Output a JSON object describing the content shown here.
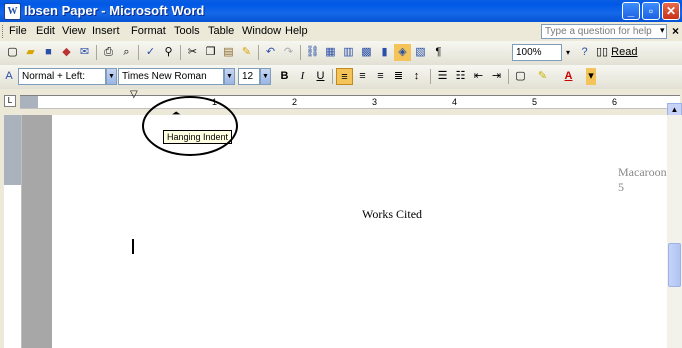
{
  "window": {
    "title": "Ibsen Paper - Microsoft Word",
    "app_icon_glyph": "W",
    "buttons": {
      "minimize": "_",
      "maximize": "▫",
      "close": "✕"
    }
  },
  "menu": {
    "items": [
      "File",
      "Edit",
      "View",
      "Insert",
      "Format",
      "Tools",
      "Table",
      "Window",
      "Help"
    ],
    "help_placeholder": "Type a question for help",
    "help_caret": "▾",
    "close_doc": "×"
  },
  "standard_toolbar": {
    "zoom": "100%",
    "read_label": "Read"
  },
  "formatting_toolbar": {
    "style": "Normal + Left:",
    "font": "Times New Roman",
    "size": "12",
    "bold": "B",
    "italic": "I",
    "underline": "U"
  },
  "ruler": {
    "numbers": [
      "1",
      "2",
      "3",
      "4",
      "5",
      "6"
    ],
    "corner_glyph": "L"
  },
  "document": {
    "header": "Macaroon 5",
    "heading": "Works Cited"
  },
  "tooltip": {
    "text": "Hanging Indent"
  }
}
